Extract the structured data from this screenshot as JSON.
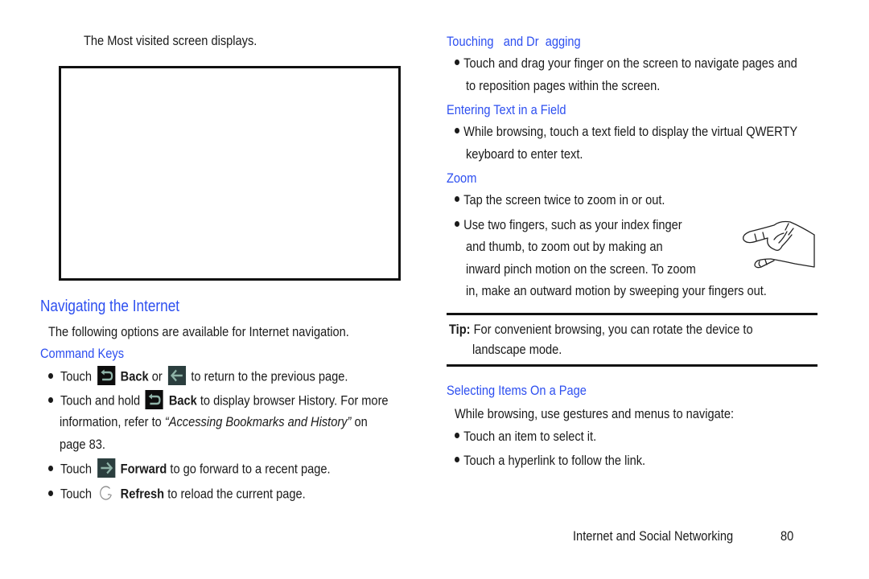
{
  "left": {
    "intro": "The Most visited screen displays.",
    "heading": "Navigating the Internet",
    "lead": "The following options are available for Internet navigation.",
    "subheading": "Command Keys",
    "bullets": [
      {
        "pre": "Touch",
        "label": "Back",
        "mid": "or",
        "post": "to return to the previous page."
      },
      {
        "pre": "Touch and hold",
        "label": "Back",
        "post": "to display browser History. For more",
        "line2_pre": "information, refer to",
        "line2_ref": "“Accessing Bookmarks and History”",
        "line2_post": "on",
        "line3": "page 83."
      },
      {
        "pre": "Touch",
        "label": "Forward",
        "post": "to go forward to a recent page."
      },
      {
        "pre": "Touch",
        "label": "Refresh",
        "post": "to reload the current page."
      }
    ],
    "icons": {
      "back": "back-key-icon",
      "back_arrow": "back-arrow-icon",
      "forward": "forward-arrow-icon",
      "refresh": "refresh-icon"
    }
  },
  "right": {
    "touching": {
      "heading": "Touching   and Dr  agging",
      "line1": "Touch and drag your finger on the screen to navigate pages and",
      "line2": "to reposition pages within the screen."
    },
    "entering": {
      "heading": "Entering Text in a Field",
      "line1": "While browsing, touch a text field to display the virtual QWERTY",
      "line2": "keyboard to enter text."
    },
    "zoom": {
      "heading": "Zoom",
      "bullet1": "Tap the screen twice to zoom in or out.",
      "bullet2_line1": "Use two fingers, such as your index finger",
      "bullet2_line2": "and thumb, to zoom out by making an",
      "bullet2_line3": "inward pinch motion on the screen. To zoom",
      "bullet2_line4": "in, make an outward motion by sweeping your fingers out."
    },
    "tip": {
      "label": "Tip:",
      "line1": "For convenient browsing, you can rotate the device to",
      "line2": "landscape mode."
    },
    "selecting": {
      "heading": "Selecting Items On a Page",
      "lead": "While browsing, use gestures and menus to navigate:",
      "bullet1": "Touch an item to select it.",
      "bullet2": "Touch a hyperlink to follow the link."
    }
  },
  "footer": {
    "section": "Internet and Social Networking",
    "page": "80"
  },
  "colors": {
    "heading": "#2d4ff0",
    "text": "#1a1a1a",
    "icon_bg_dark": "#0d0d0d",
    "icon_bg_teal": "#2b3e3e",
    "icon_stroke": "#8fb3a8"
  }
}
